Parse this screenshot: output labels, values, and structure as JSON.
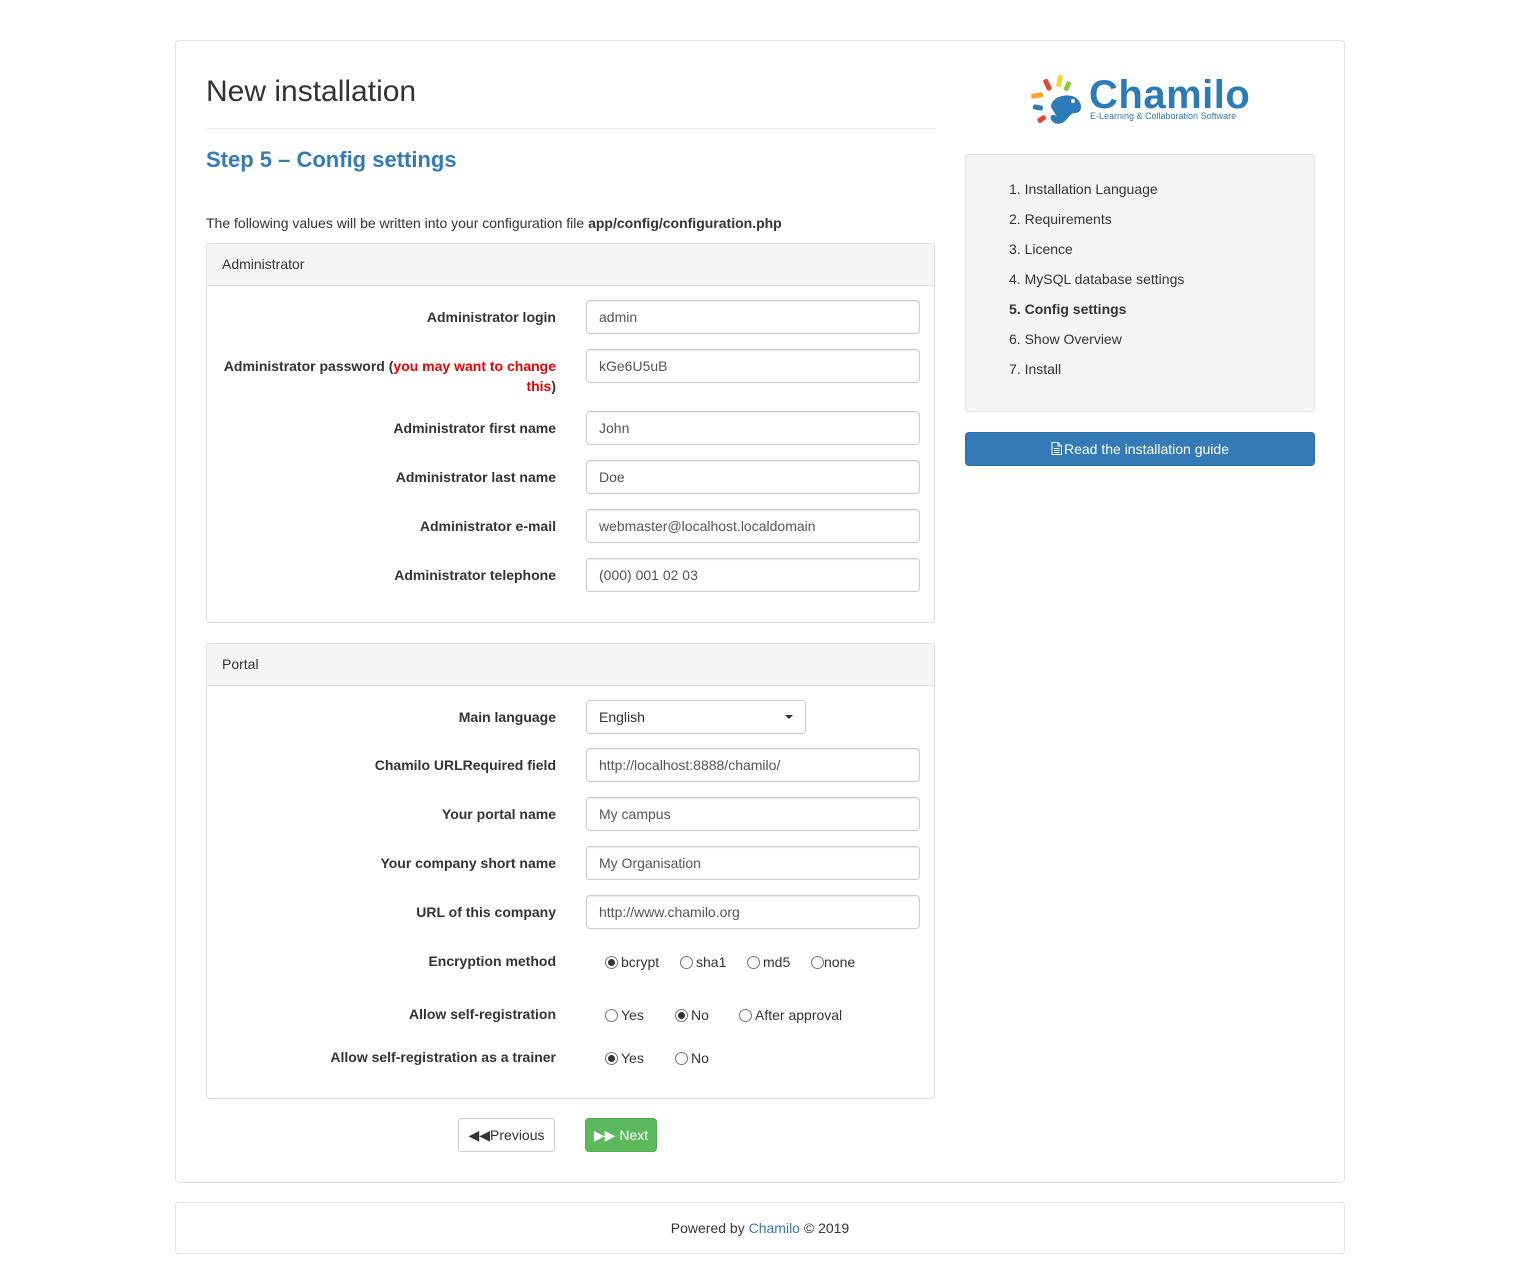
{
  "page_title": "New installation",
  "step_title": "Step 5 – Config settings",
  "intro": {
    "text": "The following values will be written into your configuration file ",
    "file": "app/config/configuration.php"
  },
  "admin": {
    "legend": "Administrator",
    "login_label": "Administrator login",
    "login_value": "admin",
    "password_label": "Administrator password ",
    "password_paren_open": "(",
    "password_warning": "you may want to change this",
    "password_paren_close": ")",
    "password_value": "kGe6U5uB",
    "firstname_label": "Administrator first name",
    "firstname_value": "John",
    "lastname_label": "Administrator last name",
    "lastname_value": "Doe",
    "email_label": "Administrator e-mail",
    "email_value": "webmaster@localhost.localdomain",
    "phone_label": "Administrator telephone",
    "phone_value": "(000) 001 02 03"
  },
  "portal": {
    "legend": "Portal",
    "language_label": "Main language",
    "language_value": "English",
    "url_label": "Chamilo URLRequired field",
    "url_value": "http://localhost:8888/chamilo/",
    "portal_name_label": "Your portal name",
    "portal_name_value": "My campus",
    "company_label": "Your company short name",
    "company_value": "My Organisation",
    "company_url_label": "URL of this company",
    "company_url_value": "http://www.chamilo.org",
    "encryption_label": "Encryption method",
    "encryption_options": [
      "bcrypt",
      "sha1",
      "md5",
      "none"
    ],
    "encryption_selected": "bcrypt",
    "selfreg_label": "Allow self-registration",
    "selfreg_options": [
      "Yes",
      "No",
      "After approval"
    ],
    "selfreg_selected": "No",
    "trainer_label": "Allow self-registration as a trainer",
    "trainer_options": [
      "Yes",
      "No"
    ],
    "trainer_selected": "Yes"
  },
  "buttons": {
    "previous": "Previous",
    "next": "Next",
    "guide": "Read the installation guide"
  },
  "logo": {
    "name": "Chamilo",
    "tagline": "E-Learning & Collaboration Software"
  },
  "steps": [
    {
      "num": "1.",
      "label": "Installation Language",
      "active": false
    },
    {
      "num": "2.",
      "label": "Requirements",
      "active": false
    },
    {
      "num": "3.",
      "label": "Licence",
      "active": false
    },
    {
      "num": "4.",
      "label": "MySQL database settings",
      "active": false
    },
    {
      "num": "5.",
      "label": "Config settings",
      "active": true
    },
    {
      "num": "6.",
      "label": "Show Overview",
      "active": false
    },
    {
      "num": "7.",
      "label": "Install",
      "active": false
    }
  ],
  "footer": {
    "prefix": "Powered by ",
    "link": "Chamilo",
    "suffix": " © 2019"
  },
  "colors": {
    "primary": "#337ab7",
    "success": "#5cb85c",
    "warning_text": "#ee0000"
  }
}
